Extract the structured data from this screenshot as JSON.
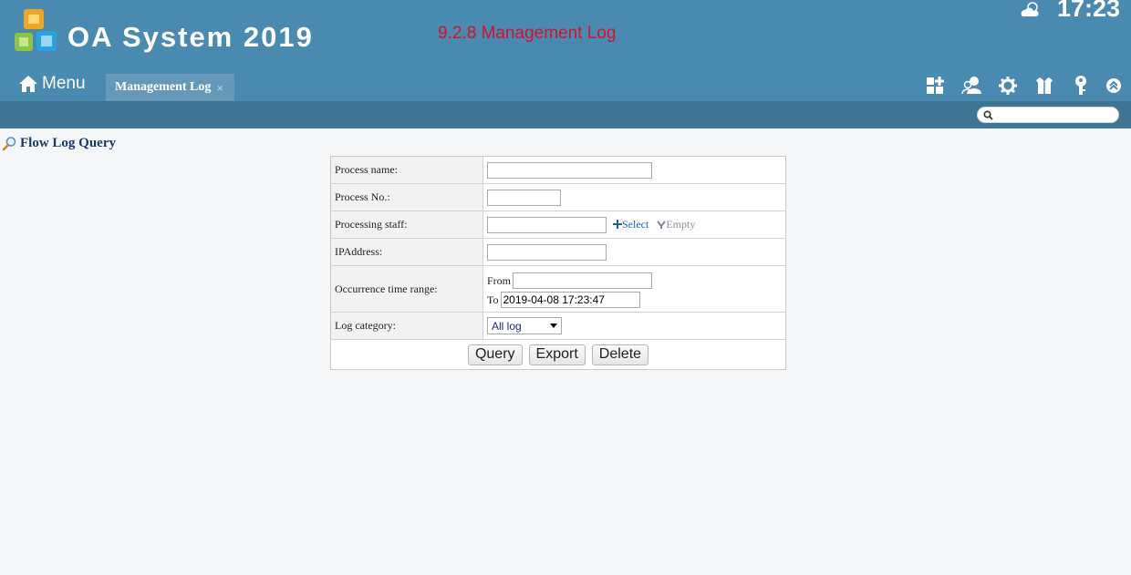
{
  "header": {
    "app_title": "OA System 2019",
    "page_caption": "9.2.8 Management Log",
    "clock": "17:23",
    "menu_label": "Menu",
    "tab": {
      "label": "Management Log",
      "close": "×"
    },
    "toolbar_icons": [
      "apps-icon",
      "users-icon",
      "gear-icon",
      "shirt-icon",
      "key-icon",
      "collapse-icon"
    ]
  },
  "search": {
    "placeholder": ""
  },
  "section": {
    "title": "Flow Log Query"
  },
  "form": {
    "process_name_label": "Process name:",
    "process_no_label": "Process No.:",
    "staff_label": "Processing staff:",
    "select_link": "Select",
    "empty_link": "Empty",
    "ip_label": "IPAddress:",
    "time_range_label": "Occurrence time range:",
    "from_label": "From",
    "to_label": "To",
    "to_value": "2019-04-08 17:23:47",
    "category_label": "Log category:",
    "category_value": "All log"
  },
  "buttons": {
    "query": "Query",
    "export": "Export",
    "delete": "Delete"
  },
  "colors": {
    "header_bg": "#4a8ab0",
    "subbar_bg": "#3e7595",
    "tab_bg": "#6699b9",
    "caption_red": "#d9102a"
  }
}
